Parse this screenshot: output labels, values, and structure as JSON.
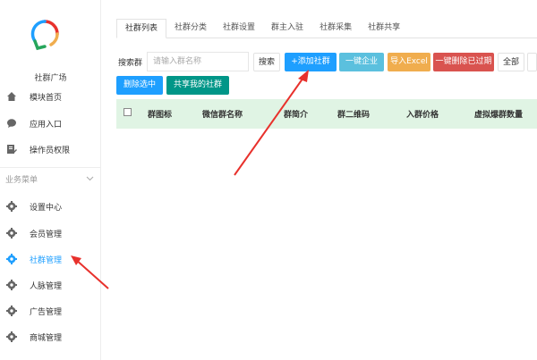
{
  "sidebar": {
    "app_name": "社群广场",
    "top_items": [
      {
        "label": "模块首页",
        "icon": "home-icon"
      },
      {
        "label": "应用入口",
        "icon": "chat-bubble-icon"
      },
      {
        "label": "操作员权限",
        "icon": "user-edit-icon"
      }
    ],
    "section_label": "业务菜单",
    "section_items": [
      {
        "label": "设置中心",
        "icon": "gear-icon"
      },
      {
        "label": "会员管理",
        "icon": "gear-icon"
      },
      {
        "label": "社群管理",
        "icon": "gear-icon",
        "active": true
      },
      {
        "label": "人脉管理",
        "icon": "gear-icon"
      },
      {
        "label": "广告管理",
        "icon": "gear-icon"
      },
      {
        "label": "商城管理",
        "icon": "gear-icon"
      }
    ]
  },
  "tabs": [
    "社群列表",
    "社群分类",
    "社群设置",
    "群主入驻",
    "社群采集",
    "社群共享"
  ],
  "toolbar": {
    "search_label": "搜索群",
    "search_placeholder": "请输入群名称",
    "search_button": "搜索",
    "add_button": "+添加社群",
    "enterprise_button": "一键企业",
    "import_button": "导入Excel",
    "delete_expired_button": "一键删除已过期",
    "all_button": "全部",
    "delete_selected_button": "删除选中",
    "share_button": "共享我的社群"
  },
  "table": {
    "columns": [
      "群图标",
      "微信群名称",
      "群简介",
      "群二维码",
      "入群价格",
      "虚拟爆群数量"
    ]
  },
  "colors": {
    "accent": "#1e9fff",
    "green": "#009688",
    "orange": "#f0ad4e",
    "red": "#d9534f",
    "annotation": "#e8312c"
  }
}
